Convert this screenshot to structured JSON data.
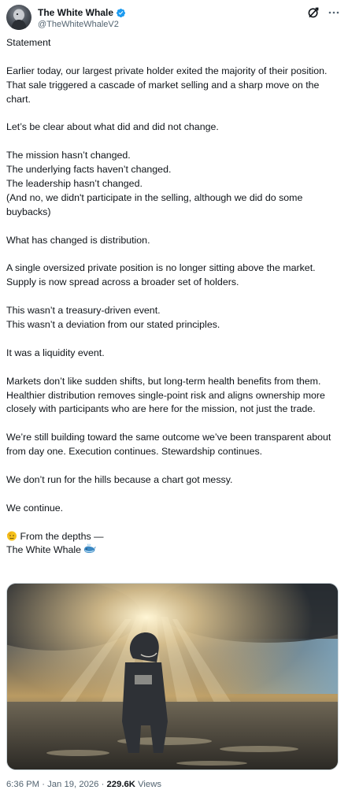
{
  "author": {
    "display_name": "The White Whale",
    "handle": "@TheWhiteWhaleV2",
    "verified": true,
    "verified_color": "#1d9bf0"
  },
  "header_icons": [
    "grok-icon",
    "more-icon"
  ],
  "tweet": {
    "paragraphs": [
      [
        "Statement"
      ],
      [
        "Earlier today, our largest private holder exited the majority of their position. That sale triggered a cascade of market selling and a sharp move on the chart."
      ],
      [
        "Let’s be clear about what did and did not change."
      ],
      [
        "The mission hasn’t changed.",
        "The underlying facts haven’t changed.",
        "The leadership hasn’t changed.",
        "(And no, we didn't participate in the selling, although we did do some buybacks)"
      ],
      [
        "What has changed is distribution."
      ],
      [
        "A single oversized private position is no longer sitting above the market. Supply is now spread across a broader set of holders."
      ],
      [
        "This wasn’t a treasury-driven event.",
        "This wasn’t a deviation from our stated principles."
      ],
      [
        "It was a liquidity event."
      ],
      [
        "Markets don’t like sudden shifts, but long-term health benefits from them. Healthier distribution removes single-point risk and aligns ownership more closely with participants who are here for the mission, not just the trade."
      ],
      [
        "We’re still building toward the same outcome we’ve been transparent about from day one. Execution continues. Stewardship continues."
      ],
      [
        "We don’t run for the hills because a chart got messy."
      ],
      [
        "We continue."
      ]
    ],
    "signoff": {
      "line1": "From the depths —",
      "line1_icon": "saluting-face-emoji",
      "line2": "The White Whale",
      "line2_icon": "whale-emoji"
    }
  },
  "media": {
    "icon": "image",
    "alt_subject": "whale-headed figure in coat under sunbeams"
  },
  "meta": {
    "time": "6:36 PM",
    "separator": "·",
    "date": "Jan 19, 2026",
    "views_count": "229.6K",
    "views_label": "Views"
  },
  "colors": {
    "text": "#0f1419",
    "secondary": "#536471",
    "accent": "#1d9bf0"
  }
}
